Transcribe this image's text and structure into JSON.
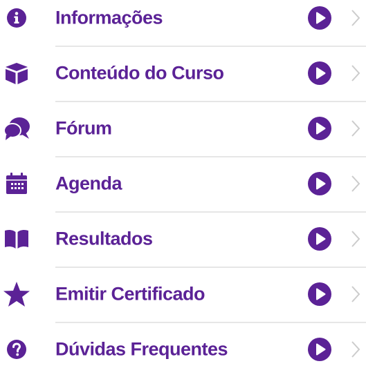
{
  "colors": {
    "accent": "#5b2296",
    "chevron": "#cccccc",
    "divider": "#e6e6e6",
    "background": "#ffffff"
  },
  "menu": {
    "items": [
      {
        "label": "Informações",
        "icon": "info-icon"
      },
      {
        "label": "Conteúdo do Curso",
        "icon": "cube-icon"
      },
      {
        "label": "Fórum",
        "icon": "chat-bubbles-icon"
      },
      {
        "label": "Agenda",
        "icon": "calendar-icon"
      },
      {
        "label": "Resultados",
        "icon": "open-book-icon"
      },
      {
        "label": "Emitir Certificado",
        "icon": "star-icon"
      },
      {
        "label": "Dúvidas Frequentes",
        "icon": "question-icon"
      }
    ],
    "action_icon": "play-circle-icon",
    "arrow_icon": "chevron-right-icon"
  }
}
